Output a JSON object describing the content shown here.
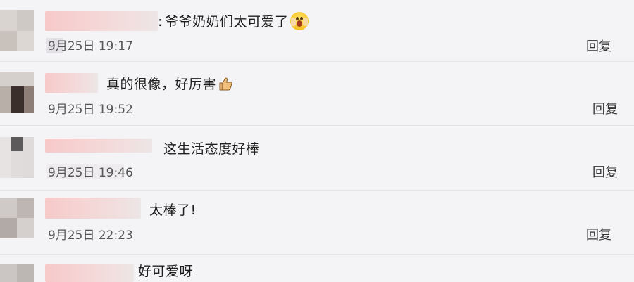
{
  "comments": [
    {
      "text": "爷爷奶奶们太可爱了",
      "emoji": "screaming-face-emoji",
      "time": "9月25日 19:17",
      "time_visible": "9月25日 19:17",
      "reply": "回复"
    },
    {
      "text": "真的很像，好厉害",
      "emoji": "thumbs-up-emoji",
      "time": "9月25日 19:52",
      "reply": "回复"
    },
    {
      "text": "这生活态度好棒",
      "time": "9月25日 19:46",
      "reply": "回复"
    },
    {
      "text": "太棒了!",
      "time": "9月25日 22:23",
      "reply": "回复"
    },
    {
      "text": "好可爱呀"
    }
  ],
  "colors": {
    "background": "#f4f4f6",
    "divider": "#e4e4e6",
    "username_blur": "#f5d0d0"
  }
}
